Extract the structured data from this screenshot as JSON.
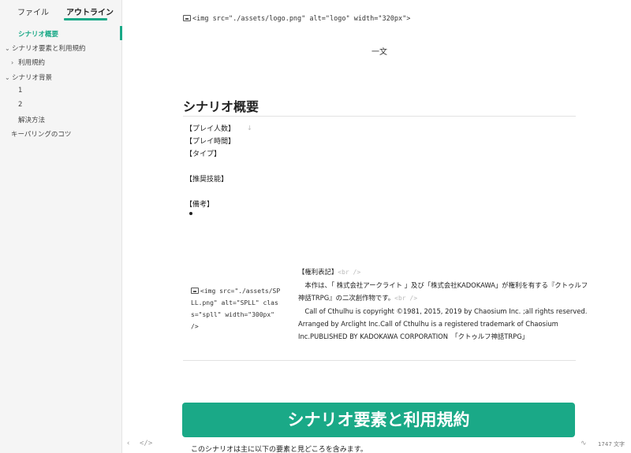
{
  "sidebar": {
    "tabs": [
      {
        "label": "ファイル"
      },
      {
        "label": "アウトライン"
      }
    ],
    "items": [
      {
        "label": "シナリオ概要"
      },
      {
        "label": "シナリオ要素と利用規約"
      },
      {
        "label": "利用規約"
      },
      {
        "label": "シナリオ背景"
      },
      {
        "label": "1"
      },
      {
        "label": "2"
      },
      {
        "label": "解決方法"
      },
      {
        "label": "キーパリングのコツ"
      }
    ]
  },
  "status": {
    "word_count": "1747 文字"
  },
  "doc": {
    "logo_code": "<img src=\"./assets/logo.png\" alt=\"logo\" width=\"320px\">",
    "center_text": "一文",
    "heading1": "シナリオ概要",
    "fields": [
      "【プレイ人数】",
      "【プレイ時間】",
      "【タイプ】",
      "【推奨技能】",
      "【備考】"
    ],
    "spll_code": "<img src=\"./assets/SPLL.png\" alt=\"SPLL\" class=\"spll\" width=\"300px\" />",
    "rights": {
      "title": "【権利表記】",
      "br": "<br />",
      "line1": "　本作は、「 株式会社アークライト 」及び「株式会社KADOKAWA」が権利を有する『クトゥルフ神話TRPG』の二次創作物です。",
      "line2": "　Call of Cthulhu is copyright ©1981, 2015, 2019 by Chaosium Inc. ;all rights reserved. Arranged by Arclight Inc.Call of Cthulhu is a registered trademark of Chaosium Inc.PUBLISHED BY KADOKAWA CORPORATION　「クトゥルフ神話TRPG」"
    },
    "banner": "シナリオ要素と利用規約",
    "bottom_text": "このシナリオは主に以下の要素と見どころを含みます。"
  },
  "colors": {
    "accent": "#1aa987"
  }
}
